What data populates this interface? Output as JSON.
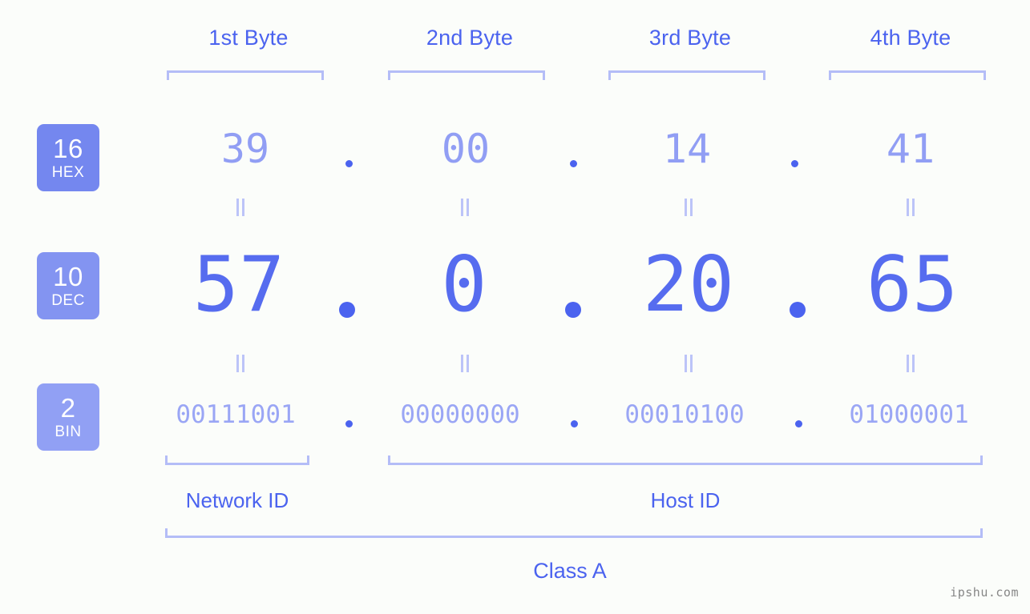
{
  "background_color": "#fbfdfa",
  "colors": {
    "accent_strong": "#4b63ef",
    "accent_mid": "#566cef",
    "accent_light": "#919ef4",
    "accent_pale": "#b4bdf7",
    "badge_hex": "#7487ef",
    "badge_dec": "#8394f1",
    "badge_bin": "#91a0f4",
    "watermark": "#878787"
  },
  "byte_headers": [
    {
      "label": "1st Byte"
    },
    {
      "label": "2nd Byte"
    },
    {
      "label": "3rd Byte"
    },
    {
      "label": "4th Byte"
    }
  ],
  "bases": [
    {
      "num": "16",
      "name": "HEX"
    },
    {
      "num": "10",
      "name": "DEC"
    },
    {
      "num": "2",
      "name": "BIN"
    }
  ],
  "rows": {
    "hex": {
      "octets": [
        "39",
        "00",
        "14",
        "41"
      ]
    },
    "dec": {
      "octets": [
        "57",
        "0",
        "20",
        "65"
      ]
    },
    "bin": {
      "octets": [
        "00111001",
        "00000000",
        "00010100",
        "01000001"
      ]
    }
  },
  "separator": ".",
  "equals_symbol": "=",
  "segments": {
    "network_id": "Network ID",
    "host_id": "Host ID"
  },
  "class_label": "Class A",
  "watermark": "ipshu.com"
}
